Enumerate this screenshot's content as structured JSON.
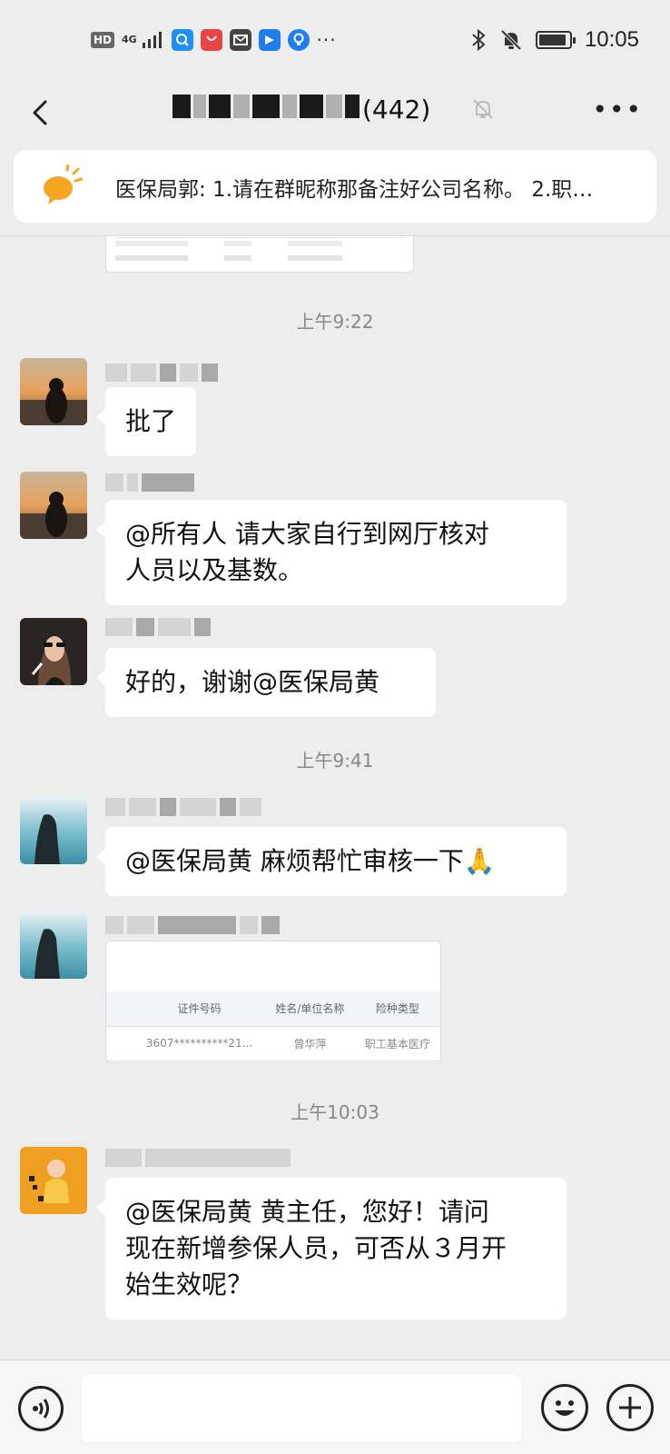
{
  "status_bar": {
    "hd_badge": "HD",
    "network": "4G",
    "overflow": "···",
    "time": "10:05",
    "battery_level": 0.9,
    "icons": [
      "hd-icon",
      "signal-icon",
      "browser-icon",
      "huawei-appgallery-icon",
      "mail-app-icon",
      "store-app-icon",
      "lightbulb-app-icon",
      "bluetooth-icon",
      "mute-bell-icon",
      "battery-icon"
    ]
  },
  "nav": {
    "title_suffix": "(442)",
    "icons": [
      "back-icon",
      "mute-bell-icon",
      "more-icon"
    ]
  },
  "notice": {
    "text": "医保局郭: 1.请在群昵称那备注好公司名称。 2.职…",
    "icon": "megaphone-icon",
    "accent": "#f5a623"
  },
  "chat": {
    "messages": [
      {
        "type": "time",
        "text": "上午9:22"
      },
      {
        "type": "text",
        "text": "批了"
      },
      {
        "type": "text",
        "lines": [
          "@所有人  请大家自行到网厅核对",
          "人员以及基数。"
        ]
      },
      {
        "type": "text",
        "text": "好的，谢谢@医保局黄"
      },
      {
        "type": "time",
        "text": "上午9:41"
      },
      {
        "type": "text",
        "text": "@医保局黄  麻烦帮忙审核一下🙏"
      },
      {
        "type": "image",
        "table_headers": [
          "证件号码",
          "姓名/单位名称",
          "险种类型"
        ],
        "table_row": [
          "3607**********21...",
          "曾华萍",
          "职工基本医疗"
        ]
      },
      {
        "type": "time",
        "text": "上午10:03"
      },
      {
        "type": "text",
        "lines": [
          "@医保局黄  黄主任，您好！请问",
          "现在新增参保人员，可否从３月开",
          "始生效呢？"
        ]
      }
    ]
  },
  "input_bar": {
    "placeholder": "",
    "icons": [
      "voice-icon",
      "emoji-icon",
      "plus-icon"
    ]
  }
}
